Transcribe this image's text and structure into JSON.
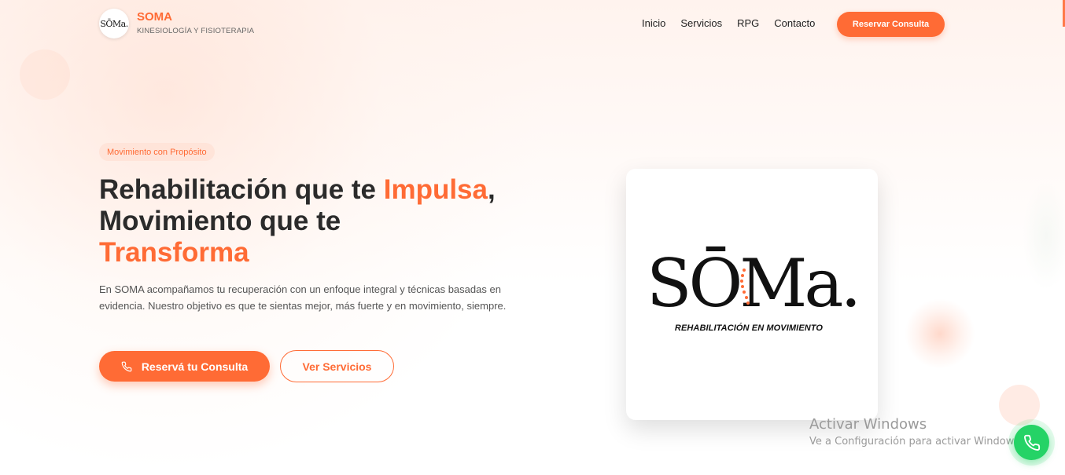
{
  "brand": {
    "logo_text": "SŌMa.",
    "name": "SOMA",
    "subtitle": "KINESIOLOGÍA Y FISIOTERAPIA"
  },
  "nav": {
    "items": [
      "Inicio",
      "Servicios",
      "RPG",
      "Contacto"
    ],
    "cta": "Reservar Consulta"
  },
  "hero": {
    "tagline": "Movimiento con Propósito",
    "title_part1": "Rehabilitación que te ",
    "title_accent1": "Impulsa",
    "title_part2": ",",
    "title_part3": "Movimiento que te",
    "title_accent2": "Transforma",
    "description": "En SOMA acompañamos tu recuperación con un enfoque integral y técnicas basadas en evidencia. Nuestro objetivo es que te sientas mejor, más fuerte y en movimiento, siempre.",
    "primary_button": "Reservá tu Consulta",
    "secondary_button": "Ver Servicios"
  },
  "card": {
    "logo_text": "SŌMa.",
    "logo_subtitle": "REHABILITACIÓN EN MOVIMIENTO"
  },
  "watermark": {
    "title": "Activar Windows",
    "subtitle": "Ve a Configuración para activar Windows."
  },
  "icons": {
    "phone": "phone-icon",
    "whatsapp": "whatsapp-icon"
  },
  "colors": {
    "accent": "#ff6b35",
    "whatsapp": "#25d366",
    "text": "#2b2b2b"
  }
}
